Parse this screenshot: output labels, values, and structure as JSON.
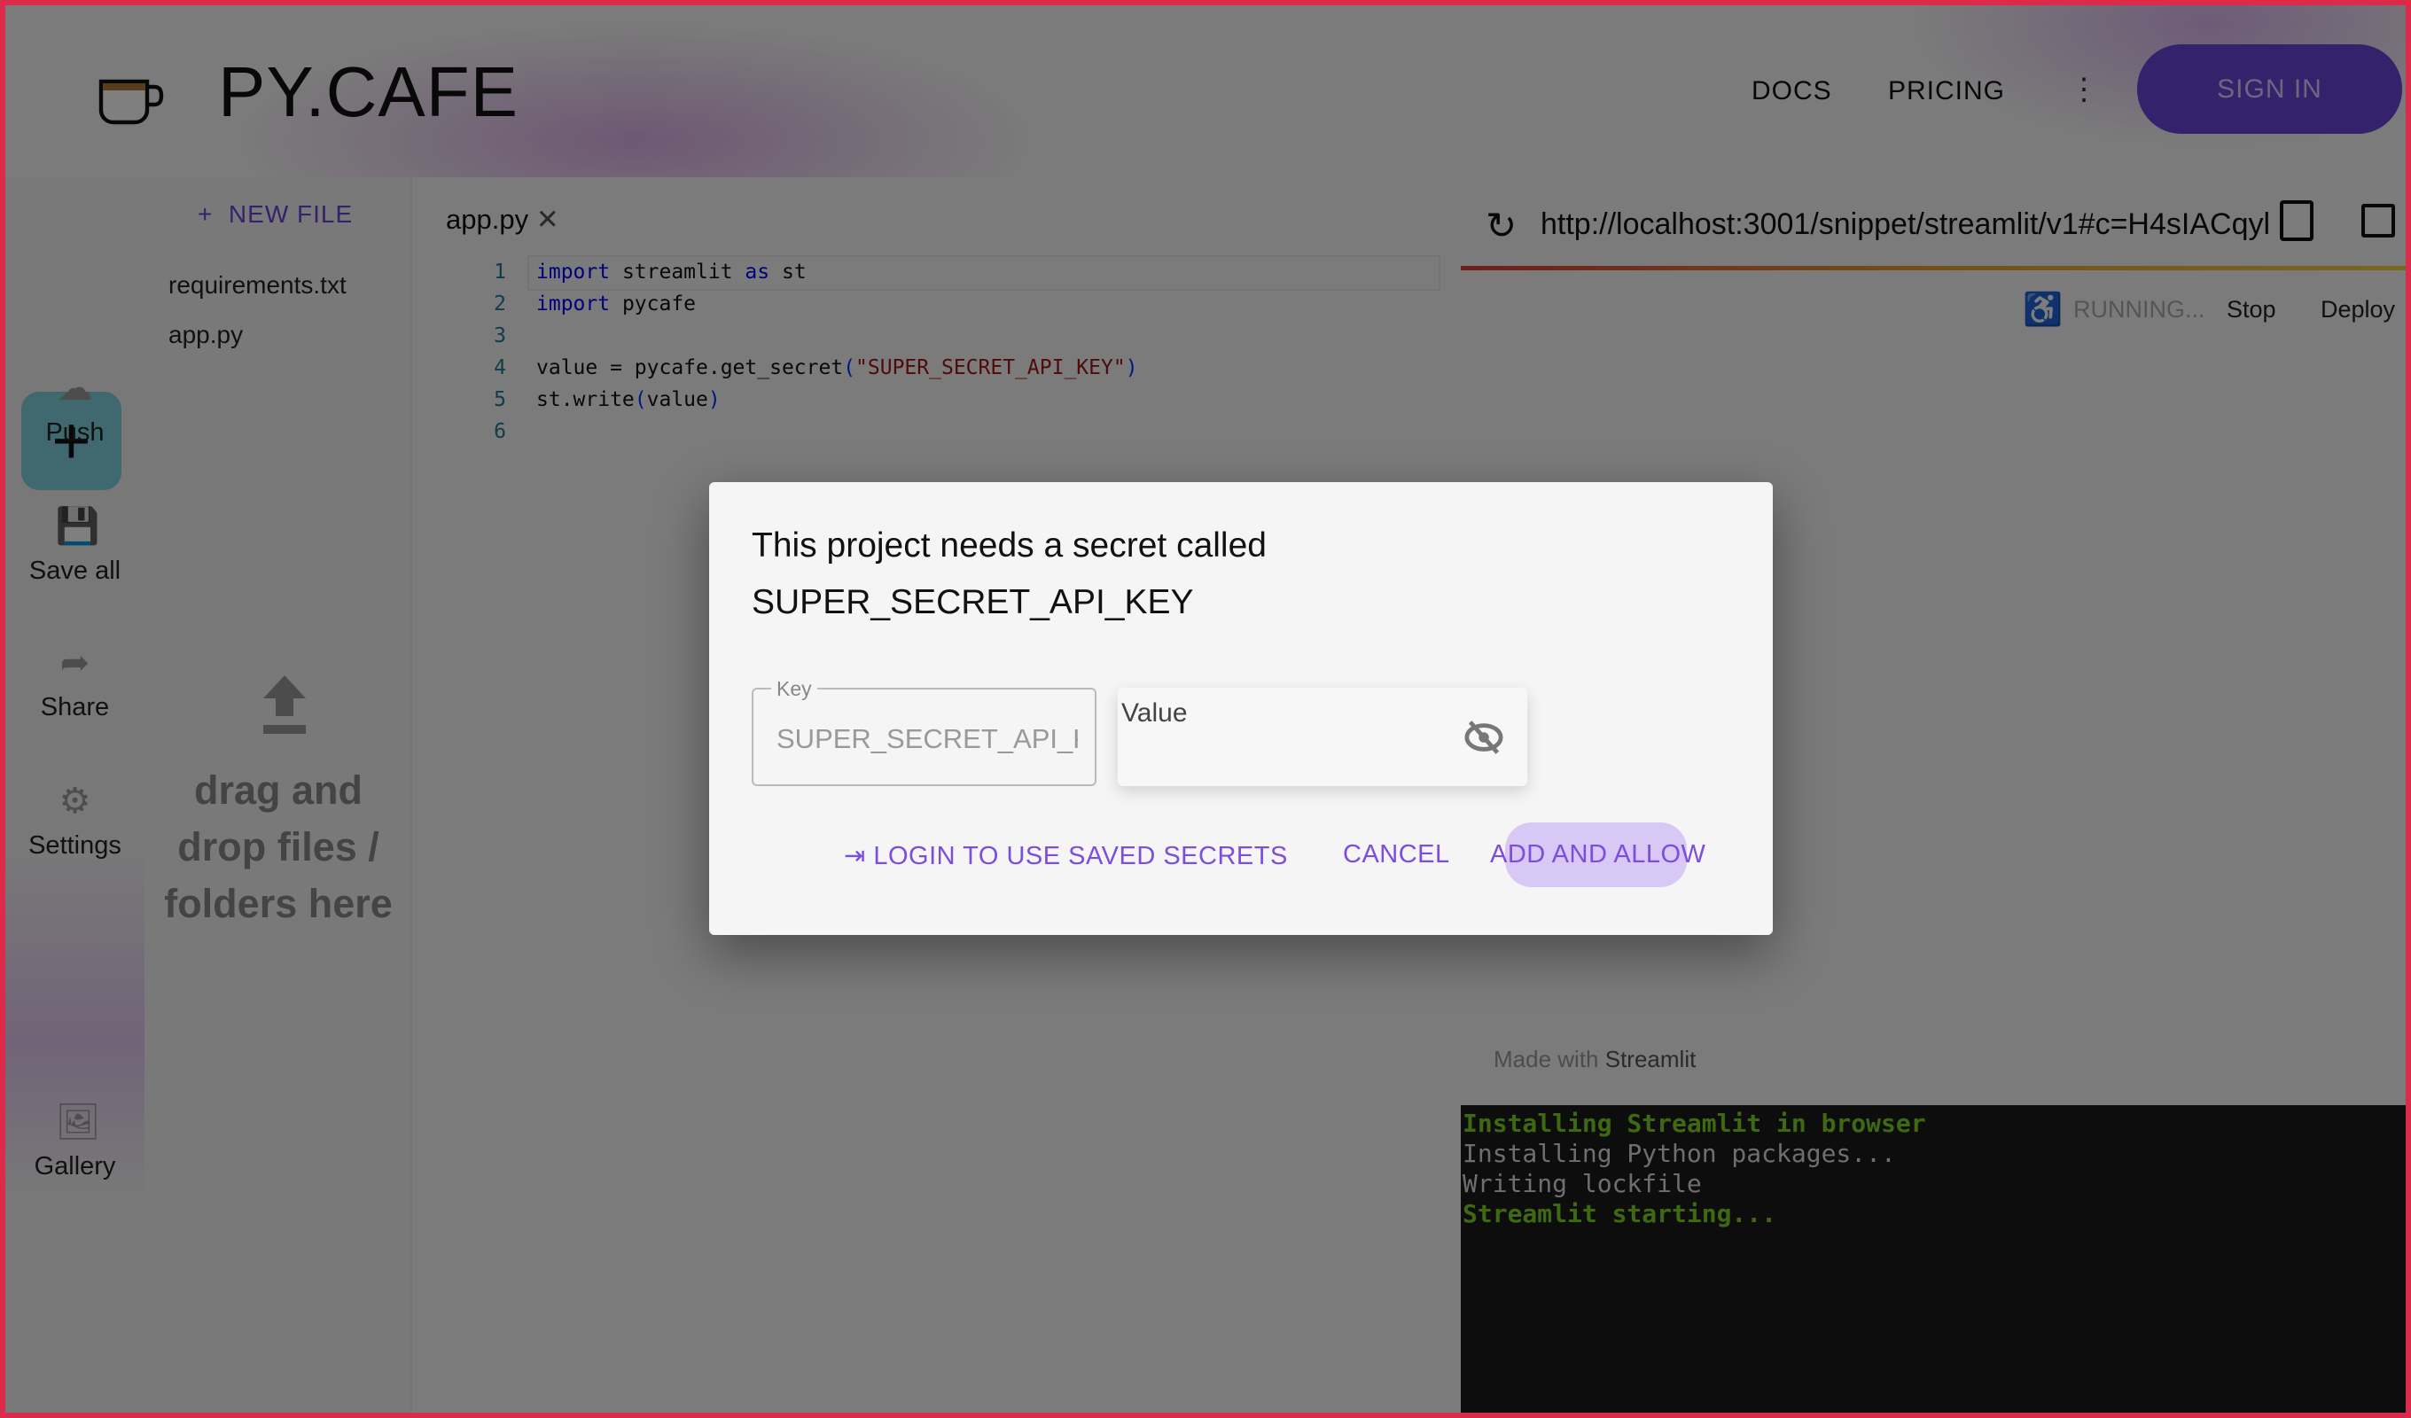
{
  "header": {
    "logo_text": "PY.CAFE",
    "nav": [
      "DOCS",
      "PRICING"
    ],
    "sign_in": "SIGN IN",
    "accent": "#6a44d8"
  },
  "rail": {
    "items": [
      {
        "label": "Push",
        "icon": "cloud-upload-icon"
      },
      {
        "label": "Save all",
        "icon": "save-icon"
      },
      {
        "label": "Share",
        "icon": "share-icon"
      },
      {
        "label": "Settings",
        "icon": "gear-icon"
      },
      {
        "label": "Gallery",
        "icon": "gallery-icon"
      }
    ]
  },
  "files": {
    "new_file": "NEW FILE",
    "items": [
      "requirements.txt",
      "app.py"
    ],
    "drop_text": [
      "drag and",
      "drop files /",
      "folders here"
    ]
  },
  "editor": {
    "tab": "app.py",
    "lines": [
      "1",
      "2",
      "3",
      "4",
      "5",
      "6"
    ]
  },
  "preview": {
    "url": "http://localhost:3001/snippet/streamlit/v1#c=H4sIACqyl",
    "status": "RUNNING...",
    "stop": "Stop",
    "deploy": "Deploy",
    "footer_prefix": "Made with",
    "footer_brand": "Streamlit"
  },
  "terminal": [
    "Installing Streamlit in browser",
    "Installing Python packages...",
    "Writing lockfile",
    "Streamlit starting..."
  ],
  "dialog": {
    "title_line1": "This project needs a secret called",
    "title_line2": "SUPER_SECRET_API_KEY",
    "key_label": "Key",
    "key_value": "SUPER_SECRET_API_KEY",
    "value_label": "Value",
    "login": "LOGIN TO USE SAVED SECRETS",
    "cancel": "CANCEL",
    "add": "ADD AND ALLOW"
  }
}
